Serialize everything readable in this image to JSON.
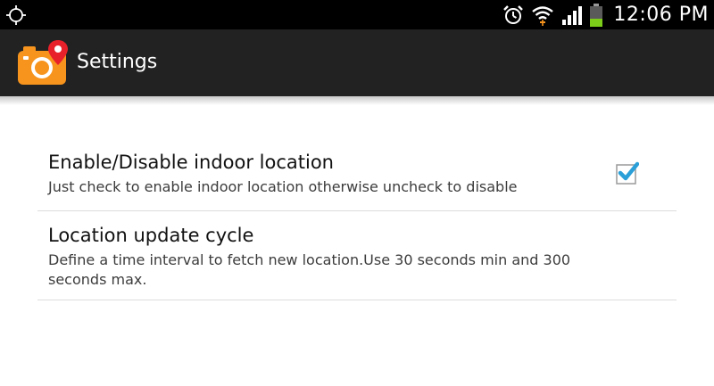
{
  "status_bar": {
    "time": "12:06 PM",
    "icons": [
      "gps-icon",
      "alarm-icon",
      "wifi-icon",
      "signal-icon",
      "battery-icon"
    ],
    "battery_color": "#7ccc1a"
  },
  "action_bar": {
    "title": "Settings",
    "icon": "camera-location-icon",
    "accent": "#f7941d",
    "pin_color": "#e8202a"
  },
  "preferences": [
    {
      "title": "Enable/Disable indoor location",
      "summary": "Just check to enable indoor location otherwise uncheck to disable",
      "checked": true
    },
    {
      "title": "Location update cycle",
      "summary": "Define a time interval to fetch new location.Use 30 seconds min and 300 seconds max."
    }
  ],
  "checkbox_color": "#2a9fd8"
}
